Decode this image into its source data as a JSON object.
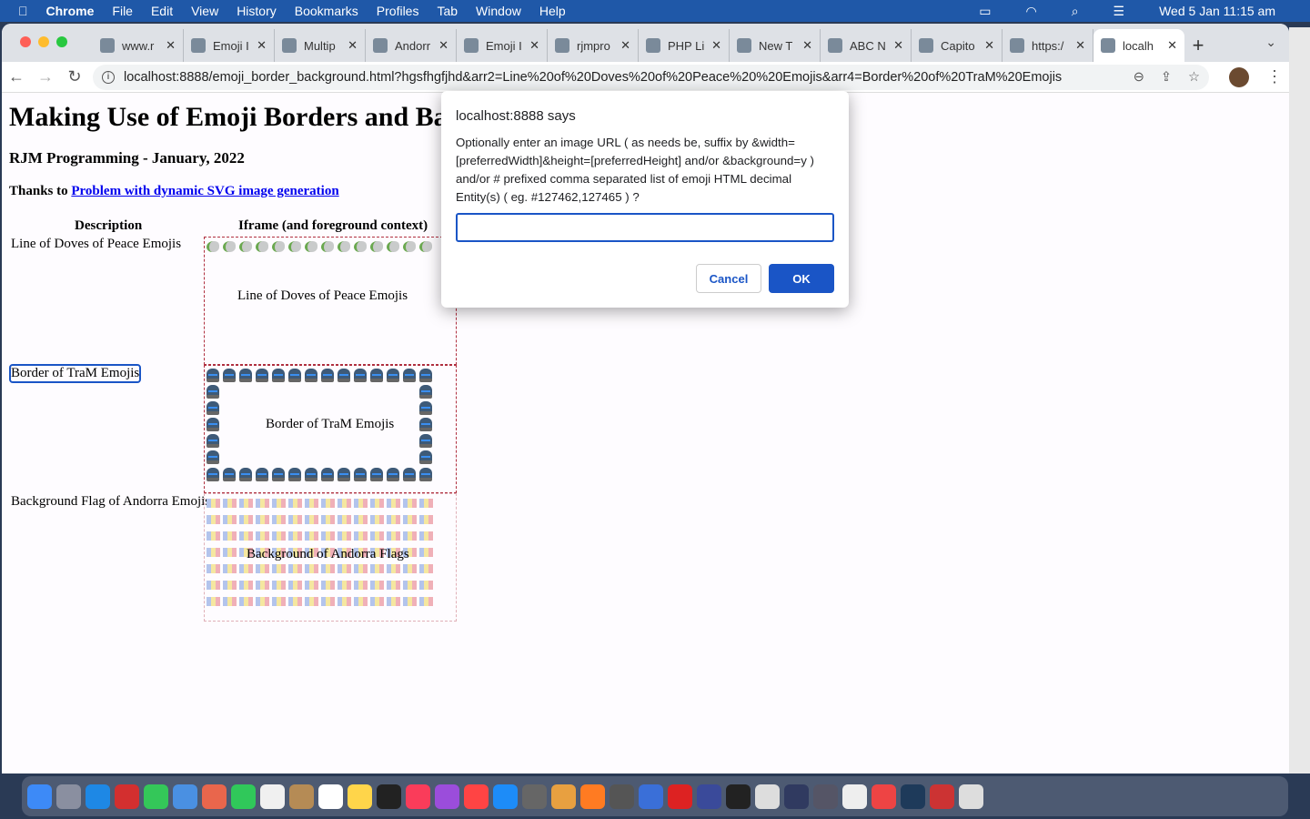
{
  "menubar": {
    "app": "Chrome",
    "items": [
      "File",
      "Edit",
      "View",
      "History",
      "Bookmarks",
      "Profiles",
      "Tab",
      "Window",
      "Help"
    ],
    "clock": "Wed 5 Jan  11:15 am"
  },
  "tabs": [
    {
      "title": "www.r"
    },
    {
      "title": "Emoji I"
    },
    {
      "title": "Multip"
    },
    {
      "title": "Andorr"
    },
    {
      "title": "Emoji I"
    },
    {
      "title": "rjmpro"
    },
    {
      "title": "PHP Li"
    },
    {
      "title": "New T"
    },
    {
      "title": "ABC N"
    },
    {
      "title": "Capito"
    },
    {
      "title": "https:/"
    },
    {
      "title": "localh",
      "active": true
    }
  ],
  "address": {
    "url": "localhost:8888/emoji_border_background.html?hgsfhgfjhd&arr2=Line%20of%20Doves%20of%20Peace%20%20Emojis&arr4=Border%20of%20TraM%20Emojis"
  },
  "page": {
    "title": "Making Use of Emoji Borders and Bac",
    "subtitle": "RJM Programming - January, 2022",
    "thanks_prefix": "Thanks to ",
    "thanks_link": "Problem with dynamic SVG image generation",
    "headers": [
      "Description",
      "Iframe (and foreground context)"
    ],
    "rows": [
      {
        "desc": "Line of Doves of Peace Emojis",
        "caption": "Line of Doves of Peace Emojis",
        "emoji": "dove"
      },
      {
        "desc": "Border of TraM Emojis",
        "caption": "Border of TraM Emojis",
        "emoji": "tram"
      },
      {
        "desc": "Background Flag of Andorra Emojis",
        "caption": "Background of Andorra Flags",
        "emoji": "andorra-flag"
      }
    ]
  },
  "dialog": {
    "title": "localhost:8888 says",
    "message": "Optionally enter an image URL ( as needs be, suffix by &width=[preferredWidth]&height=[preferredHeight] and/or &background=y ) and/or # prefixed comma separated list of emoji HTML decimal Entity(s) ( eg. #127462,127465 ) ?",
    "input_value": "",
    "cancel": "Cancel",
    "ok": "OK"
  },
  "colors": {
    "menubar": "#1f58a8",
    "accent": "#1a55c6",
    "frame_border": "#b03040"
  }
}
